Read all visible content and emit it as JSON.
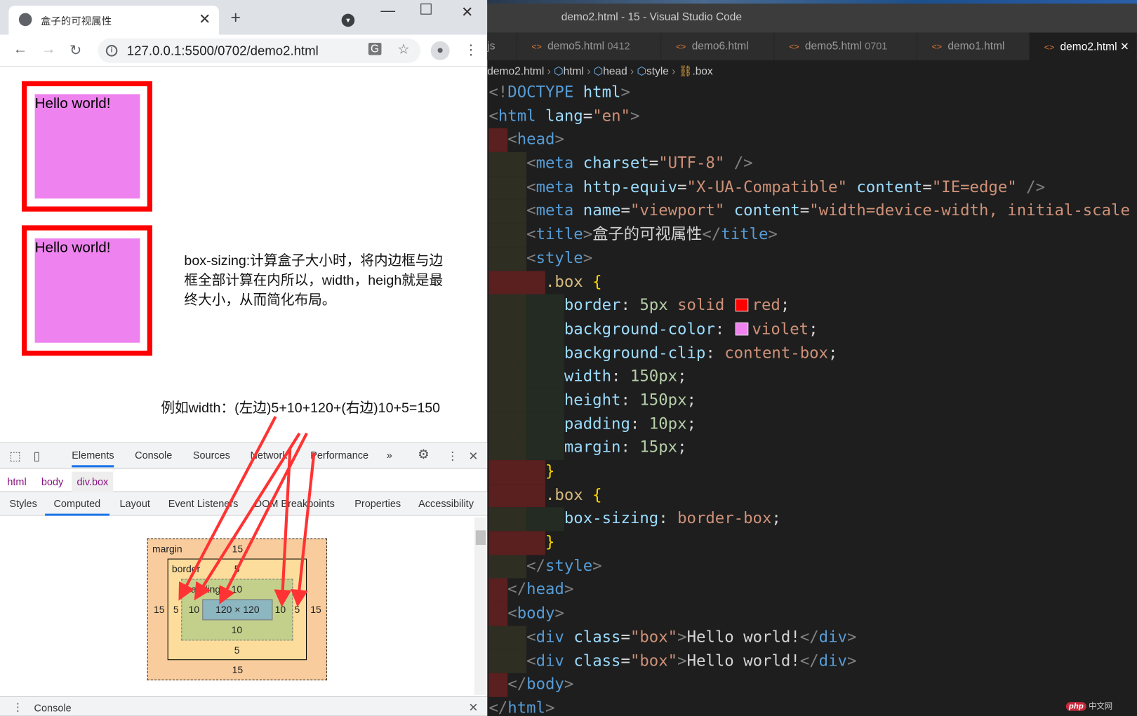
{
  "browser": {
    "tab_title": "盒子的可视属性",
    "url": "127.0.0.1:5500/0702/demo2.html",
    "page": {
      "boxes": [
        {
          "text": "Hello world!"
        },
        {
          "text": "Hello world!"
        }
      ],
      "description": "box-sizing:计算盒子大小时，将内边框与边框全部计算在内所以，width，heigh就是最终大小，从而简化布局。",
      "example": "例如width：(左边)5+10+120+(右边)10+5=150",
      "border_color": "#ff0000",
      "background_color": "#ee82ee"
    },
    "devtools": {
      "tabs": [
        "Elements",
        "Console",
        "Sources",
        "Network",
        "Performance",
        "»"
      ],
      "active_tab": "Elements",
      "breadcrumb": [
        "html",
        "body",
        "div.box"
      ],
      "subtabs": [
        "Styles",
        "Computed",
        "Layout",
        "Event Listeners",
        "DOM Breakpoints",
        "Properties",
        "Accessibility"
      ],
      "active_subtab": "Computed",
      "box_model": {
        "margin_label": "margin",
        "margin": {
          "top": "15",
          "right": "15",
          "bottom": "15",
          "left": "15"
        },
        "border_label": "border",
        "border": {
          "top": "5",
          "right": "5",
          "bottom": "5",
          "left": "5"
        },
        "padding_label": "padding",
        "padding": {
          "top": "10",
          "right": "10",
          "bottom": "10",
          "left": "10"
        },
        "content": "120 × 120"
      },
      "drawer_label": "Console"
    }
  },
  "vscode": {
    "window_title": "demo2.html - 15 - Visual Studio Code",
    "tabs": [
      {
        "name": "js",
        "suffix": ""
      },
      {
        "name": "demo5.html",
        "suffix": "0412"
      },
      {
        "name": "demo6.html",
        "suffix": ""
      },
      {
        "name": "demo5.html",
        "suffix": "0701"
      },
      {
        "name": "demo1.html",
        "suffix": ""
      },
      {
        "name": "demo2.html",
        "suffix": "",
        "active": true
      }
    ],
    "breadcrumb": [
      "demo2.html",
      "html",
      "head",
      "style",
      ".box"
    ],
    "watermark": "php 中文网",
    "code": [
      [
        [
          "pb",
          "<!"
        ],
        [
          "tg",
          "DOCTYPE"
        ],
        [
          "tx",
          " "
        ],
        [
          "at",
          "html"
        ],
        [
          "pb",
          ">"
        ]
      ],
      [
        [
          "pb",
          "<"
        ],
        [
          "tg",
          "html"
        ],
        [
          "tx",
          " "
        ],
        [
          "at",
          "lang"
        ],
        [
          "tx",
          "="
        ],
        [
          "sv",
          "\"en\""
        ],
        [
          "pb",
          ">"
        ]
      ],
      [
        [
          "ws",
          "  "
        ],
        [
          "pb",
          "<"
        ],
        [
          "tg",
          "head"
        ],
        [
          "pb",
          ">"
        ]
      ],
      [
        [
          "ws",
          "    "
        ],
        [
          "pb",
          "<"
        ],
        [
          "tg",
          "meta"
        ],
        [
          "tx",
          " "
        ],
        [
          "at",
          "charset"
        ],
        [
          "tx",
          "="
        ],
        [
          "sv",
          "\"UTF-8\""
        ],
        [
          "tx",
          " "
        ],
        [
          "pb",
          "/>"
        ]
      ],
      [
        [
          "ws",
          "    "
        ],
        [
          "pb",
          "<"
        ],
        [
          "tg",
          "meta"
        ],
        [
          "tx",
          " "
        ],
        [
          "at",
          "http-equiv"
        ],
        [
          "tx",
          "="
        ],
        [
          "sv",
          "\"X-UA-Compatible\""
        ],
        [
          "tx",
          " "
        ],
        [
          "at",
          "content"
        ],
        [
          "tx",
          "="
        ],
        [
          "sv",
          "\"IE=edge\""
        ],
        [
          "tx",
          " "
        ],
        [
          "pb",
          "/>"
        ]
      ],
      [
        [
          "ws",
          "    "
        ],
        [
          "pb",
          "<"
        ],
        [
          "tg",
          "meta"
        ],
        [
          "tx",
          " "
        ],
        [
          "at",
          "name"
        ],
        [
          "tx",
          "="
        ],
        [
          "sv",
          "\"viewport\""
        ],
        [
          "tx",
          " "
        ],
        [
          "at",
          "content"
        ],
        [
          "tx",
          "="
        ],
        [
          "sv",
          "\"width=device-width, initial-scale"
        ]
      ],
      [
        [
          "ws",
          "    "
        ],
        [
          "pb",
          "<"
        ],
        [
          "tg",
          "title"
        ],
        [
          "pb",
          ">"
        ],
        [
          "tx",
          "盒子的可视属性"
        ],
        [
          "pb",
          "</"
        ],
        [
          "tg",
          "title"
        ],
        [
          "pb",
          ">"
        ]
      ],
      [
        [
          "ws",
          "    "
        ],
        [
          "pb",
          "<"
        ],
        [
          "tg",
          "style"
        ],
        [
          "pb",
          ">"
        ]
      ],
      [
        [
          "ws",
          "      "
        ],
        [
          "sel",
          ".box"
        ],
        [
          "tx",
          " "
        ],
        [
          "br",
          "{"
        ]
      ],
      [
        [
          "ws",
          "        "
        ],
        [
          "pr",
          "border"
        ],
        [
          "tx",
          ": "
        ],
        [
          "nm",
          "5px"
        ],
        [
          "tx",
          " "
        ],
        [
          "vl",
          "solid"
        ],
        [
          "tx",
          " "
        ],
        [
          "sw",
          "#ff0000"
        ],
        [
          "vl",
          "red"
        ],
        [
          "tx",
          ";"
        ]
      ],
      [
        [
          "ws",
          "        "
        ],
        [
          "pr",
          "background-color"
        ],
        [
          "tx",
          ": "
        ],
        [
          "sw",
          "#ee82ee"
        ],
        [
          "vl",
          "violet"
        ],
        [
          "tx",
          ";"
        ]
      ],
      [
        [
          "ws",
          "        "
        ],
        [
          "pr",
          "background-clip"
        ],
        [
          "tx",
          ": "
        ],
        [
          "vl",
          "content-box"
        ],
        [
          "tx",
          ";"
        ]
      ],
      [
        [
          "ws",
          "        "
        ],
        [
          "pr",
          "width"
        ],
        [
          "tx",
          ": "
        ],
        [
          "nm",
          "150px"
        ],
        [
          "tx",
          ";"
        ]
      ],
      [
        [
          "ws",
          "        "
        ],
        [
          "pr",
          "height"
        ],
        [
          "tx",
          ": "
        ],
        [
          "nm",
          "150px"
        ],
        [
          "tx",
          ";"
        ]
      ],
      [
        [
          "ws",
          "        "
        ],
        [
          "pr",
          "padding"
        ],
        [
          "tx",
          ": "
        ],
        [
          "nm",
          "10px"
        ],
        [
          "tx",
          ";"
        ]
      ],
      [
        [
          "ws",
          "        "
        ],
        [
          "pr",
          "margin"
        ],
        [
          "tx",
          ": "
        ],
        [
          "nm",
          "15px"
        ],
        [
          "tx",
          ";"
        ]
      ],
      [
        [
          "ws",
          "      "
        ],
        [
          "br",
          "}"
        ]
      ],
      [
        [
          "ws",
          "      "
        ],
        [
          "sel",
          ".box"
        ],
        [
          "tx",
          " "
        ],
        [
          "br",
          "{"
        ]
      ],
      [
        [
          "ws",
          "        "
        ],
        [
          "pr",
          "box-sizing"
        ],
        [
          "tx",
          ": "
        ],
        [
          "vl",
          "border-box"
        ],
        [
          "tx",
          ";"
        ]
      ],
      [
        [
          "ws",
          "      "
        ],
        [
          "br",
          "}"
        ]
      ],
      [
        [
          "ws",
          "    "
        ],
        [
          "pb",
          "</"
        ],
        [
          "tg",
          "style"
        ],
        [
          "pb",
          ">"
        ]
      ],
      [
        [
          "ws",
          "  "
        ],
        [
          "pb",
          "</"
        ],
        [
          "tg",
          "head"
        ],
        [
          "pb",
          ">"
        ]
      ],
      [
        [
          "ws",
          "  "
        ],
        [
          "pb",
          "<"
        ],
        [
          "tg",
          "body"
        ],
        [
          "pb",
          ">"
        ]
      ],
      [
        [
          "ws",
          "    "
        ],
        [
          "pb",
          "<"
        ],
        [
          "tg",
          "div"
        ],
        [
          "tx",
          " "
        ],
        [
          "at",
          "class"
        ],
        [
          "tx",
          "="
        ],
        [
          "sv",
          "\"box\""
        ],
        [
          "pb",
          ">"
        ],
        [
          "tx",
          "Hello world!"
        ],
        [
          "pb",
          "</"
        ],
        [
          "tg",
          "div"
        ],
        [
          "pb",
          ">"
        ]
      ],
      [
        [
          "ws",
          "    "
        ],
        [
          "pb",
          "<"
        ],
        [
          "tg",
          "div"
        ],
        [
          "tx",
          " "
        ],
        [
          "at",
          "class"
        ],
        [
          "tx",
          "="
        ],
        [
          "sv",
          "\"box\""
        ],
        [
          "pb",
          ">"
        ],
        [
          "tx",
          "Hello world!"
        ],
        [
          "pb",
          "</"
        ],
        [
          "tg",
          "div"
        ],
        [
          "pb",
          ">"
        ]
      ],
      [
        [
          "ws",
          "  "
        ],
        [
          "pb",
          "</"
        ],
        [
          "tg",
          "body"
        ],
        [
          "pb",
          ">"
        ]
      ],
      [
        [
          "pb",
          "</"
        ],
        [
          "tg",
          "html"
        ],
        [
          "pb",
          ">"
        ]
      ]
    ]
  }
}
